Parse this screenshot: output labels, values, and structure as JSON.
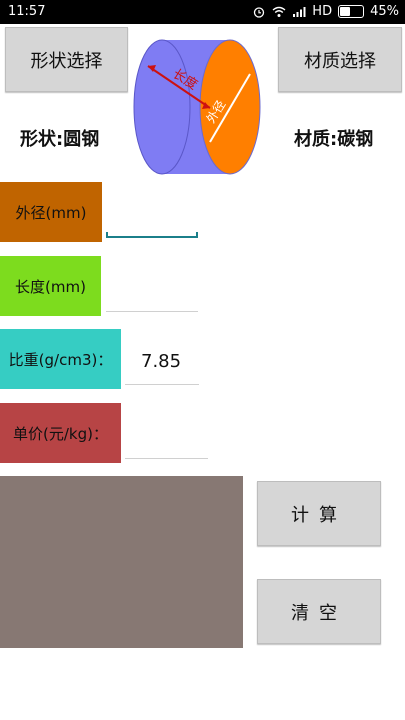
{
  "statusbar": {
    "time": "11:57",
    "network": "HD",
    "battery": "45%",
    "battery_level": 0.45
  },
  "header": {
    "shape_button": "形状选择",
    "material_button": "材质选择"
  },
  "diagram": {
    "length_label": "长度",
    "diameter_label": "外径"
  },
  "info": {
    "shape": "形状:圆钢",
    "material": "材质:碳钢"
  },
  "form": {
    "outer_diameter": {
      "label": "外径(mm)",
      "value": ""
    },
    "length": {
      "label": "长度(mm)",
      "value": ""
    },
    "specific_gravity": {
      "label": "比重(g/cm3)：",
      "value": "7.85"
    },
    "unit_price": {
      "label": "单价(元/kg)：",
      "value": ""
    }
  },
  "actions": {
    "calculate": "计算",
    "clear": "清空"
  },
  "result": {
    "text": ""
  },
  "colors": {
    "od_label": "#c06400",
    "len_label": "#7ddc1e",
    "sg_label": "#36cdc3",
    "price_label": "#b74445",
    "result_bg": "#877873",
    "cyl_side": "#7f7cf3",
    "cyl_face": "#ff7f00"
  }
}
